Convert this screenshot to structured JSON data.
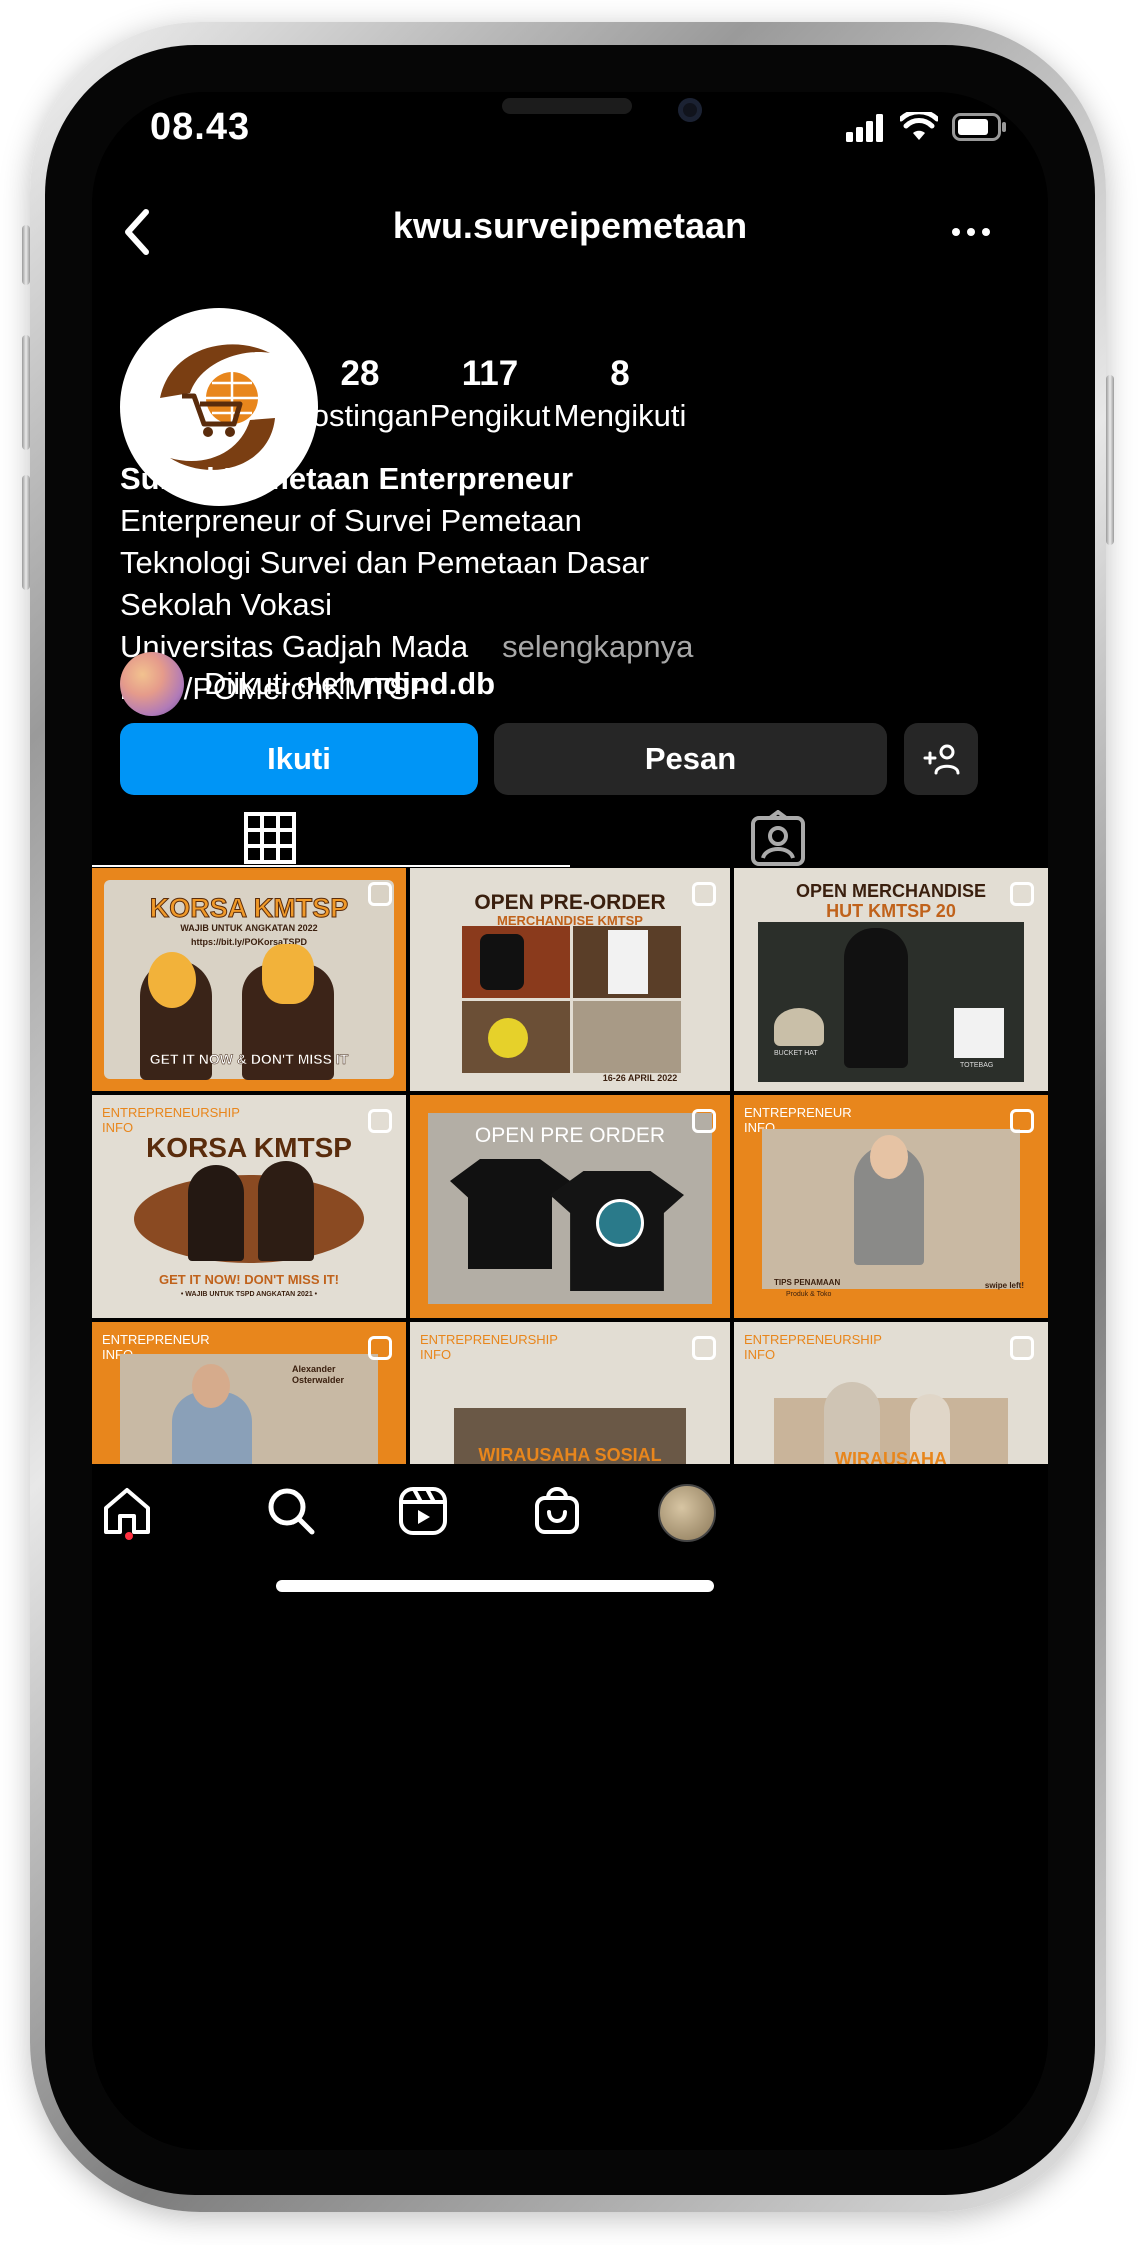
{
  "status_bar": {
    "time": "08.43"
  },
  "nav": {
    "username": "kwu.surveipemetaan"
  },
  "profile": {
    "stats": [
      {
        "value": "28",
        "label": "Postingan"
      },
      {
        "value": "117",
        "label": "Pengikut"
      },
      {
        "value": "8",
        "label": "Mengikuti"
      }
    ],
    "name": "Survei Pemetaan Enterpreneur",
    "bio_lines": [
      "Enterpreneur of Survei Pemetaan",
      "Teknologi Survei dan Pemetaan Dasar",
      "Sekolah Vokasi",
      "Universitas Gadjah Mada"
    ],
    "more_label": "selengkapnya",
    "link": "bit.ly/POMerchKMTSP",
    "followed_prefix": "Diikuti oleh ",
    "followed_user": "ndind.db"
  },
  "actions": {
    "follow_label": "Ikuti",
    "message_label": "Pesan"
  },
  "posts": [
    {
      "title": "KORSA KMTSP",
      "subtitle": "WAJIB UNTUK ANGKATAN 2022",
      "link": "https://bit.ly/POKorsaTSPD",
      "footer": "GET IT NOW & DON'T MISS IT"
    },
    {
      "title": "OPEN PRE-ORDER",
      "subtitle": "MERCHANDISE KMTSP",
      "footer": "16-26 APRIL 2022"
    },
    {
      "title": "OPEN MERCHANDISE",
      "subtitle": "HUT KMTSP 20",
      "labels": [
        "BUCKET HAT",
        "TOTEBAG"
      ]
    },
    {
      "tag": "ENTREPRENEURSHIP INFO",
      "title": "KORSA KMTSP",
      "footer": "GET IT NOW! DON'T MISS IT!",
      "footnote": "• WAJIB UNTUK TSPD ANGKATAN 2021 •"
    },
    {
      "title": "OPEN PRE ORDER"
    },
    {
      "tag": "ENTREPRENEUR INFO",
      "footer": "TIPS PENAMAAN",
      "subfooter": "Produk & Toko",
      "swipe": "swipe left!"
    },
    {
      "tag": "ENTREPRENEUR INFO",
      "caption": "Alexander Osterwalder"
    },
    {
      "tag": "ENTREPRENEURSHIP INFO",
      "footer": "WIRAUSAHA SOSIAL"
    },
    {
      "tag": "ENTREPRENEURSHIP INFO",
      "footer": "WIRAUSAHA"
    }
  ],
  "colors": {
    "accent": "#0095f6",
    "orange": "#e8861c",
    "dark_button": "#262626",
    "notif_dot": "#ff3040"
  }
}
